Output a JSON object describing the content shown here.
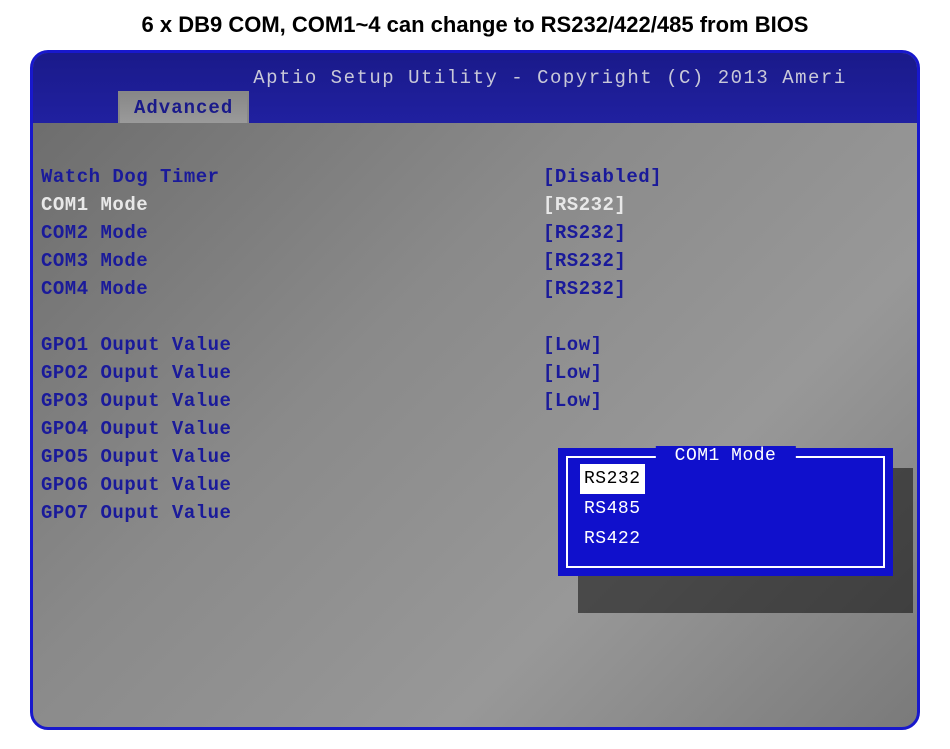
{
  "page_heading": "6 x DB9 COM, COM1~4 can change to RS232/422/485 from BIOS",
  "header": {
    "title": "Aptio Setup Utility - Copyright (C) 2013 Ameri",
    "tab": "Advanced"
  },
  "settings": [
    {
      "label": "Watch Dog Timer",
      "value": "[Disabled]",
      "selected": false
    },
    {
      "label": "COM1 Mode",
      "value": "[RS232]",
      "selected": true
    },
    {
      "label": "COM2 Mode",
      "value": "[RS232]",
      "selected": false
    },
    {
      "label": "COM3 Mode",
      "value": "[RS232]",
      "selected": false
    },
    {
      "label": "COM4 Mode",
      "value": "[RS232]",
      "selected": false
    }
  ],
  "gpo": [
    {
      "label": "GPO1 Ouput Value",
      "value": "[Low]"
    },
    {
      "label": "GPO2 Ouput Value",
      "value": "[Low]"
    },
    {
      "label": "GPO3 Ouput Value",
      "value": "[Low]"
    },
    {
      "label": "GPO4 Ouput Value",
      "value": ""
    },
    {
      "label": "GPO5 Ouput Value",
      "value": ""
    },
    {
      "label": "GPO6 Ouput Value",
      "value": ""
    },
    {
      "label": "GPO7 Ouput Value",
      "value": ""
    }
  ],
  "popup": {
    "title": "COM1 Mode",
    "options": [
      {
        "label": "RS232",
        "selected": true
      },
      {
        "label": "RS485",
        "selected": false
      },
      {
        "label": "RS422",
        "selected": false
      }
    ]
  }
}
